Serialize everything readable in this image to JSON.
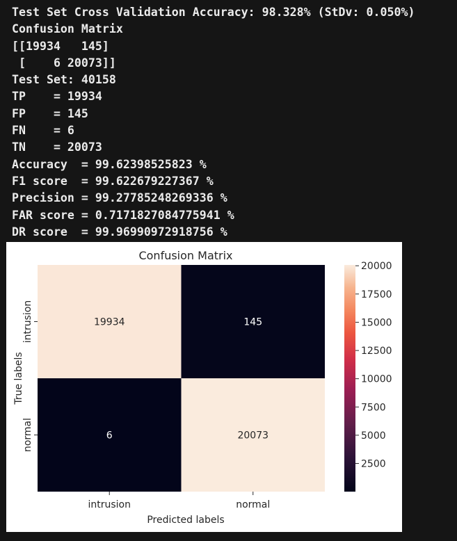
{
  "console": {
    "lines": [
      "Test Set Cross Validation Accuracy: 98.328% (StDv: 0.050%)",
      "Confusion Matrix",
      "[[19934   145]",
      " [    6 20073]]",
      "Test Set: 40158",
      "TP    = 19934",
      "FP    = 145",
      "FN    = 6",
      "TN    = 20073",
      "Accuracy  = 99.62398525823 %",
      "F1 score  = 99.622679227367 %",
      "Precision = 99.27785248269336 %",
      "FAR score = 0.7171827084775941 %",
      "DR score  = 99.96990972918756 %"
    ]
  },
  "chart_data": {
    "type": "heatmap",
    "title": "Confusion Matrix",
    "xlabel": "Predicted labels",
    "ylabel": "True labels",
    "x_categories": [
      "intrusion",
      "normal"
    ],
    "y_categories": [
      "intrusion",
      "normal"
    ],
    "values": [
      [
        19934,
        145
      ],
      [
        6,
        20073
      ]
    ],
    "colorbar": {
      "colormap": "rocket",
      "range": [
        6,
        20073
      ],
      "ticks": [
        2500,
        5000,
        7500,
        10000,
        12500,
        15000,
        17500,
        20000
      ]
    }
  }
}
